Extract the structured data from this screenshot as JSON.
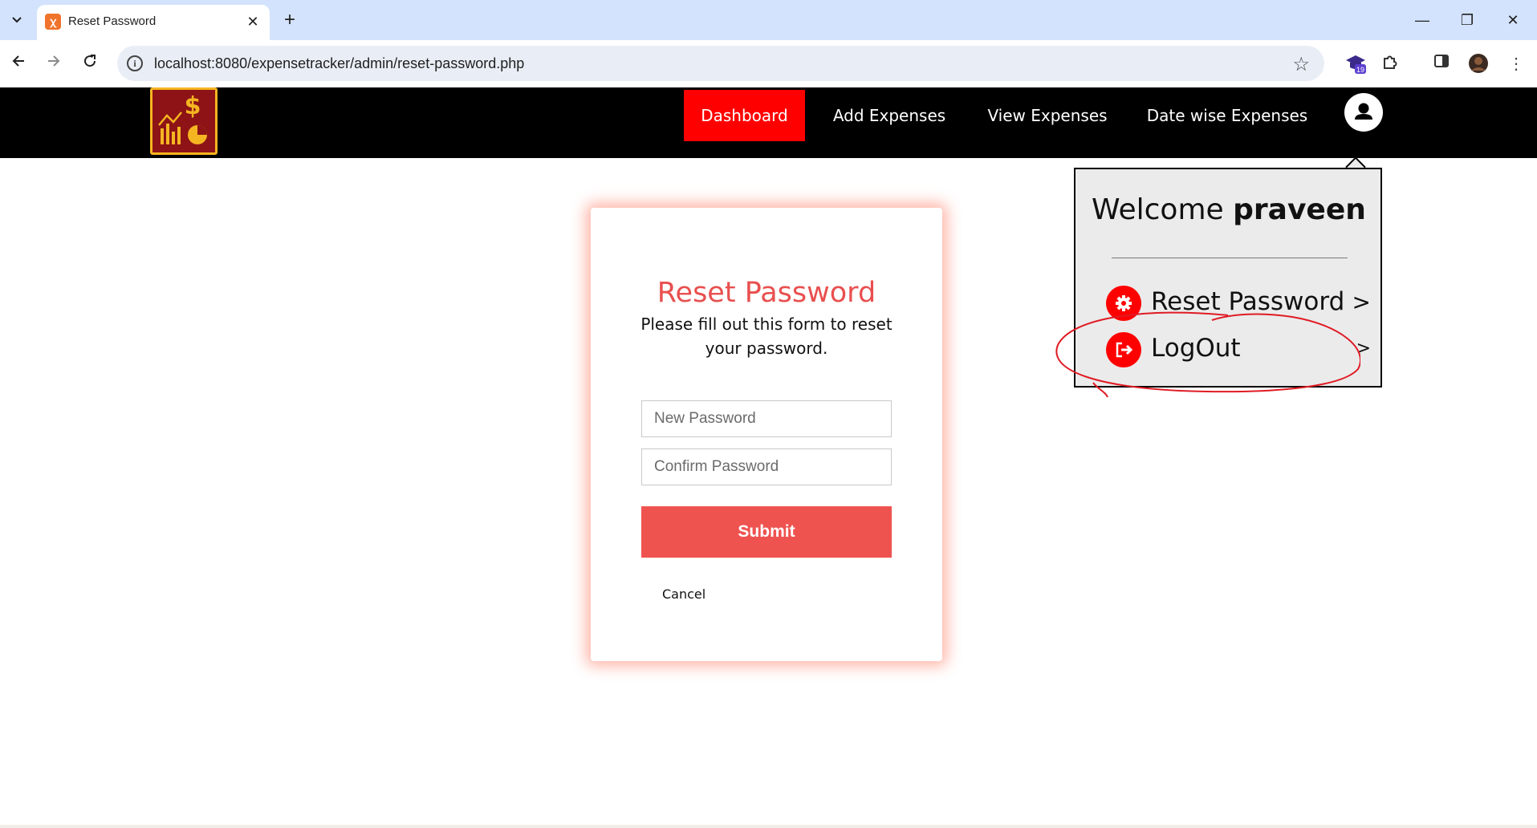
{
  "browser": {
    "tab_title": "Reset Password",
    "url": "localhost:8080/expensetracker/admin/reset-password.php",
    "extension_badge": "19"
  },
  "nav": {
    "items": [
      {
        "label": "Dashboard",
        "active": true
      },
      {
        "label": "Add Expenses",
        "active": false
      },
      {
        "label": "View Expenses",
        "active": false
      },
      {
        "label": "Date wise Expenses",
        "active": false
      }
    ]
  },
  "dropdown": {
    "welcome_prefix": "Welcome",
    "username": "praveen",
    "items": [
      {
        "label": "Reset Password",
        "icon": "gear-icon"
      },
      {
        "label": "LogOut",
        "icon": "logout-icon"
      }
    ],
    "chevron": ">"
  },
  "form": {
    "title": "Reset Password",
    "subtitle": "Please fill out this form to reset your password.",
    "new_password_placeholder": "New Password",
    "confirm_password_placeholder": "Confirm Password",
    "submit_label": "Submit",
    "cancel_label": "Cancel"
  },
  "colors": {
    "accent_red": "#ff0000",
    "title_red": "#e94f4f",
    "button_red": "#ef5350",
    "header_bg": "#000000",
    "annotation": "#e01b24"
  }
}
